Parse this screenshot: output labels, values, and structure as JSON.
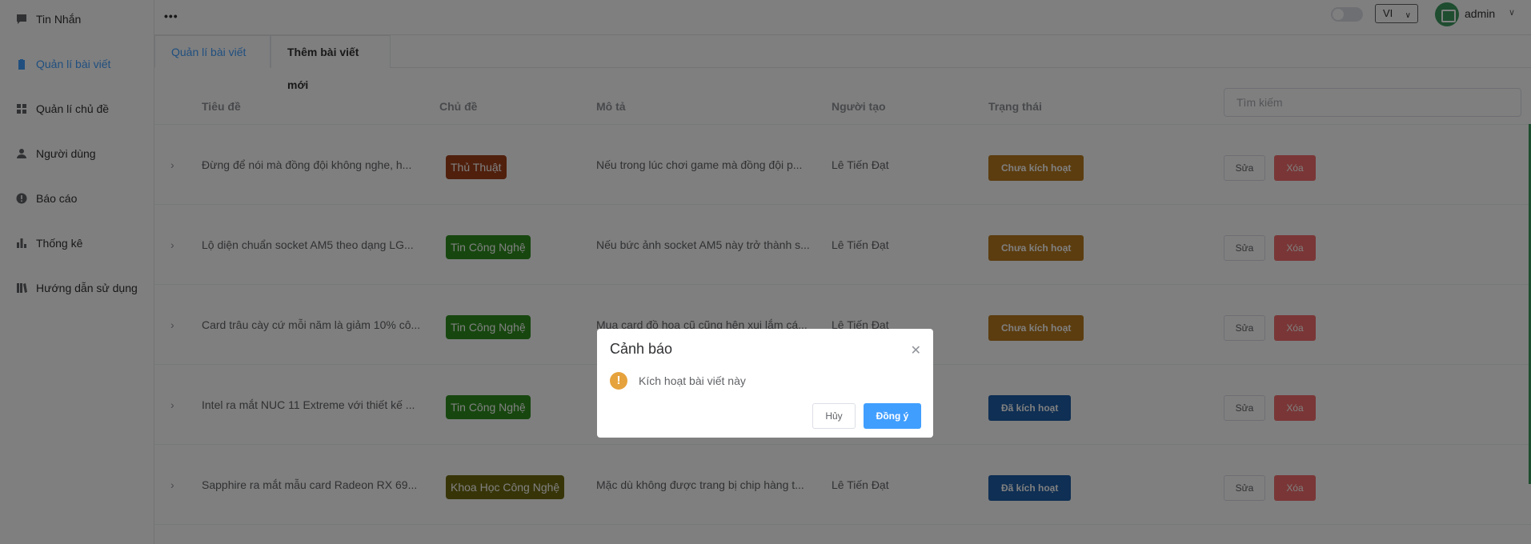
{
  "sidebar": {
    "items": [
      {
        "label": "Tin Nhắn",
        "icon": "message-icon"
      },
      {
        "label": "Quản lí bài viết",
        "icon": "clipboard-icon"
      },
      {
        "label": "Quản lí chủ đề",
        "icon": "grid-icon"
      },
      {
        "label": "Người dùng",
        "icon": "user-icon"
      },
      {
        "label": "Báo cáo",
        "icon": "alert-circle-icon"
      },
      {
        "label": "Thống kê",
        "icon": "bar-chart-icon"
      },
      {
        "label": "Hướng dẫn sử dụng",
        "icon": "book-icon"
      }
    ],
    "active_label": "Quản lí bài viết"
  },
  "header": {
    "more": "•••",
    "language": "VI",
    "username": "admin"
  },
  "tabs": [
    {
      "label": "Quản lí bài viết"
    },
    {
      "label": "Thêm bài viết mới"
    }
  ],
  "table": {
    "columns": [
      "Tiêu đề",
      "Chủ đề",
      "Mô tả",
      "Người tạo",
      "Trạng thái"
    ],
    "search_placeholder": "Tìm kiếm",
    "edit_label": "Sửa",
    "delete_label": "Xóa",
    "rows": [
      {
        "title": "Đừng để nói mà đồng đội không nghe, h...",
        "topic": "Thủ Thuật",
        "topic_color": "#a0411a",
        "description": "Nếu trong lúc chơi game mà đồng đội p...",
        "creator": "Lê Tiến Đạt",
        "status": "Chưa kích hoạt",
        "status_color": "#b87a1e"
      },
      {
        "title": "Lộ diện chuẩn socket AM5 theo dạng LG...",
        "topic": "Tin Công Nghệ",
        "topic_color": "#2f8f1e",
        "description": "Nếu bức ảnh socket AM5 này trở thành s...",
        "creator": "Lê Tiến Đạt",
        "status": "Chưa kích hoạt",
        "status_color": "#b87a1e"
      },
      {
        "title": "Card trâu cày cứ mỗi năm là giảm 10% cô...",
        "topic": "Tin Công Nghệ",
        "topic_color": "#2f8f1e",
        "description": "Mua card đồ họa cũ cũng hên xui lắm cá...",
        "creator": "Lê Tiến Đạt",
        "status": "Chưa kích hoạt",
        "status_color": "#b87a1e"
      },
      {
        "title": "Intel ra mắt NUC 11 Extreme với thiết kế ...",
        "topic": "Tin Công Nghệ",
        "topic_color": "#2f8f1e",
        "description": "",
        "creator": "",
        "status": "Đã kích hoạt",
        "status_color": "#1f5fa8"
      },
      {
        "title": "Sapphire ra mắt mẫu card Radeon RX 69...",
        "topic": "Khoa Học Công Nghệ",
        "topic_color": "#6f6a10",
        "description": "Mặc dù không được trang bị chip hàng t...",
        "creator": "Lê Tiến Đạt",
        "status": "Đã kích hoạt",
        "status_color": "#1f5fa8"
      }
    ]
  },
  "dialog": {
    "title": "Cảnh báo",
    "message": "Kích hoạt bài viết này",
    "cancel_label": "Hủy",
    "confirm_label": "Đồng ý"
  }
}
